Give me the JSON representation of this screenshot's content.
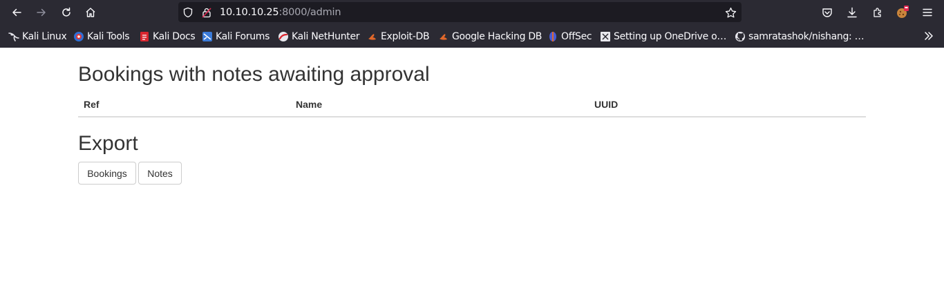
{
  "browser": {
    "url_host": "10.10.10.25",
    "url_rest": ":8000/admin",
    "bookmarks": [
      {
        "label": "Kali Linux",
        "icon": "kali-dragon-icon"
      },
      {
        "label": "Kali Tools",
        "icon": "kali-tools-icon"
      },
      {
        "label": "Kali Docs",
        "icon": "kali-docs-icon"
      },
      {
        "label": "Kali Forums",
        "icon": "kali-forums-icon"
      },
      {
        "label": "Kali NetHunter",
        "icon": "kali-nethunter-icon"
      },
      {
        "label": "Exploit-DB",
        "icon": "exploit-db-icon"
      },
      {
        "label": "Google Hacking DB",
        "icon": "ghdb-icon"
      },
      {
        "label": "OffSec",
        "icon": "offsec-icon"
      },
      {
        "label": "Setting up OneDrive o…",
        "icon": "bookmark-page-icon"
      },
      {
        "label": "samratashok/nishang: …",
        "icon": "github-icon"
      }
    ]
  },
  "page": {
    "bookings_heading": "Bookings with notes awaiting approval",
    "table_columns": [
      "Ref",
      "Name",
      "UUID"
    ],
    "export_heading": "Export",
    "export_buttons": [
      "Bookings",
      "Notes"
    ]
  },
  "colors": {
    "chrome_bg": "#2b2a33",
    "urlbar_bg": "#1c1b22",
    "text": "#333333",
    "border": "#dddddd"
  }
}
